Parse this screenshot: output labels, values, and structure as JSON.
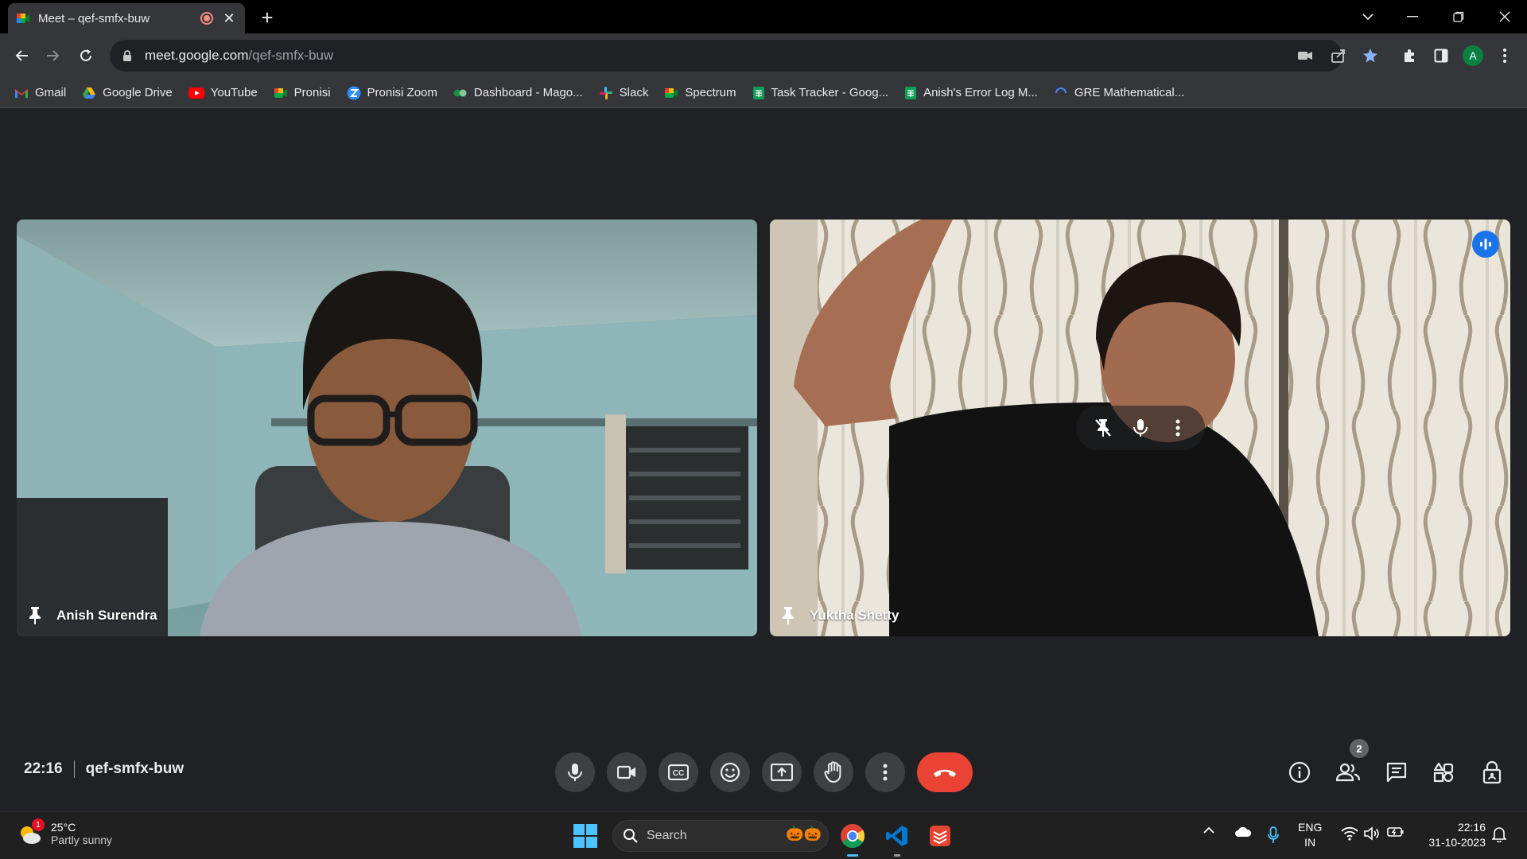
{
  "browser": {
    "tab_title": "Meet – qef-smfx-buw",
    "url_host": "meet.google.com",
    "url_path": "/qef-smfx-buw",
    "profile_initial": "A"
  },
  "bookmarks": [
    {
      "label": "Gmail",
      "icon": "gmail-icon",
      "color": "#ea4335"
    },
    {
      "label": "Google Drive",
      "icon": "google-drive-icon",
      "color": "#34a853"
    },
    {
      "label": "YouTube",
      "icon": "youtube-icon",
      "color": "#ff0000"
    },
    {
      "label": "Pronisi",
      "icon": "google-meet-icon",
      "color": "#00897b"
    },
    {
      "label": "Pronisi Zoom",
      "icon": "zoom-icon",
      "color": "#2d8cff"
    },
    {
      "label": "Dashboard - Mago...",
      "icon": "dashboard-icon",
      "color": "#1e8e3e"
    },
    {
      "label": "Slack",
      "icon": "slack-icon",
      "color": "#e01e5a"
    },
    {
      "label": "Spectrum",
      "icon": "google-meet-icon",
      "color": "#00897b"
    },
    {
      "label": "Task Tracker - Goog...",
      "icon": "google-sheets-icon",
      "color": "#0f9d58"
    },
    {
      "label": "Anish's Error Log M...",
      "icon": "google-sheets-icon",
      "color": "#0f9d58"
    },
    {
      "label": "GRE Mathematical...",
      "icon": "loading-icon",
      "color": "#4285f4"
    }
  ],
  "participants": [
    {
      "name": "Anish Surendra"
    },
    {
      "name": "Yuktha Shetty"
    }
  ],
  "meeting": {
    "time": "22:16",
    "code": "qef-smfx-buw",
    "people_count": "2"
  },
  "taskbar": {
    "temperature": "25°C",
    "condition": "Partly sunny",
    "weather_alert": "1",
    "search_placeholder": "Search",
    "lang_line1": "ENG",
    "lang_line2": "IN",
    "clock_time": "22:16",
    "clock_date": "31-10-2023"
  },
  "colors": {
    "meet_bg": "#202124",
    "control_bg": "#3c4043",
    "end_call": "#ea4335",
    "speaking_indicator": "#1a73e8",
    "windows_accent": "#4cc2ff"
  }
}
